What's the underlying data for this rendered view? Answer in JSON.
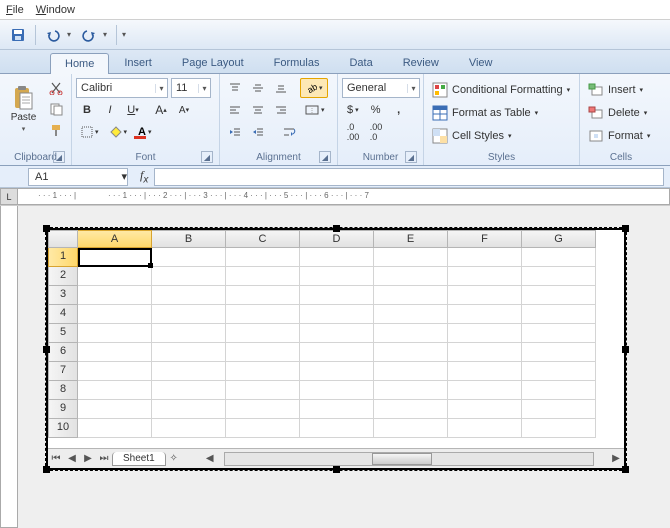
{
  "menu": {
    "file": "File",
    "window": "Window"
  },
  "tabs": [
    "Home",
    "Insert",
    "Page Layout",
    "Formulas",
    "Data",
    "Review",
    "View"
  ],
  "active_tab": 0,
  "clipboard": {
    "paste": "Paste",
    "label": "Clipboard"
  },
  "font": {
    "name": "Calibri",
    "size": "11",
    "label": "Font"
  },
  "alignment": {
    "label": "Alignment"
  },
  "number": {
    "format": "General",
    "label": "Number",
    "currency": "$",
    "percent": "%",
    "comma": ","
  },
  "styles": {
    "label": "Styles",
    "cond": "Conditional Formatting",
    "table": "Format as Table",
    "cell": "Cell Styles"
  },
  "cells": {
    "label": "Cells",
    "insert": "Insert",
    "delete": "Delete",
    "format": "Format"
  },
  "namebox": "A1",
  "columns": [
    "A",
    "B",
    "C",
    "D",
    "E",
    "F",
    "G"
  ],
  "rows": [
    1,
    2,
    3,
    4,
    5,
    6,
    7,
    8,
    9,
    10
  ],
  "selected_cell": {
    "row": 0,
    "col": 0
  },
  "sheet_tab": "Sheet1",
  "ruler_ticks": [
    "1",
    "1",
    "2",
    "3",
    "4",
    "5",
    "6",
    "7"
  ]
}
